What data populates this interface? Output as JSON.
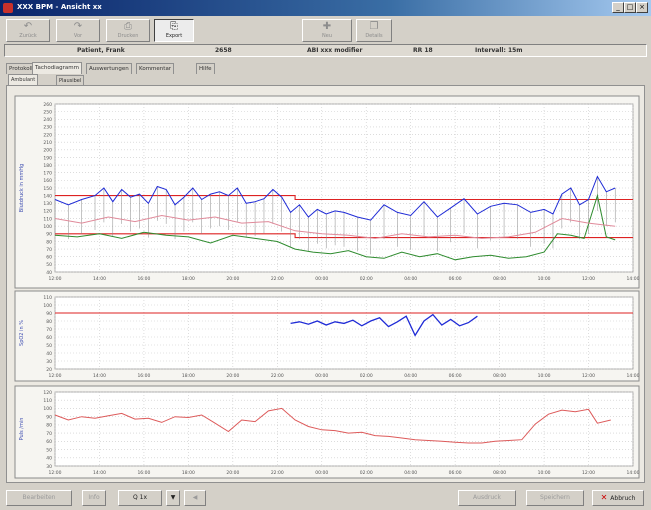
{
  "window": {
    "title": "XXX BPM  ‑ Ansicht xx"
  },
  "toolbar": {
    "buttons": [
      {
        "label": "Zurück",
        "icon": "back-icon"
      },
      {
        "label": "Vor",
        "icon": "forward-icon"
      },
      {
        "label": "Drucken",
        "icon": "print-icon"
      },
      {
        "label": "Export",
        "icon": "export-icon"
      },
      {
        "label": "Neu",
        "icon": "new-icon"
      },
      {
        "label": "Details",
        "icon": "details-icon"
      }
    ]
  },
  "infobar": {
    "patient": "Patient, Frank",
    "id": "2658",
    "device": "ABI xxx modifier",
    "rr": "RR 18",
    "interval": "Intervall: 15m"
  },
  "tabs": {
    "main": [
      "Protokoll",
      "Tachodiagramm",
      "Auswertungen",
      "Kommentar",
      "Hilfe"
    ],
    "sub": [
      "Ambulant",
      "Plausibel"
    ],
    "active_main": 1,
    "active_sub": 0
  },
  "bottom": {
    "buttons": [
      "Bearbeiten",
      "Info",
      "Q 1x",
      "▼",
      "◀",
      "Ausdruck",
      "Speichern",
      "Abbruch"
    ]
  },
  "colors": {
    "systolic": "#1f2bd6",
    "diastolic": "#2e8b2e",
    "mean": "#e08a9a",
    "threshold": "#dd2222",
    "spo2": "#1f2bd6",
    "pulse": "#dd5a5a"
  },
  "chart_data": [
    {
      "type": "line",
      "ylabel": "Blutdruck in mmHg",
      "ylim": [
        40,
        260
      ],
      "yticks": [
        40,
        50,
        60,
        70,
        80,
        90,
        100,
        110,
        120,
        130,
        140,
        150,
        160,
        170,
        180,
        190,
        200,
        210,
        220,
        230,
        240,
        250,
        260
      ],
      "xticks": [
        "12:00",
        "14:00",
        "16:00",
        "18:00",
        "20:00",
        "22:00",
        "00:00",
        "02:00",
        "04:00",
        "06:00",
        "08:00",
        "10:00",
        "12:00",
        "14:00"
      ],
      "thresholds": [
        {
          "name": "Systole Grenzwert",
          "points": [
            [
              0,
              140
            ],
            [
              5.4,
              140
            ],
            [
              5.4,
              135
            ],
            [
              13,
              135
            ]
          ]
        },
        {
          "name": "Diastole Grenzwert",
          "points": [
            [
              0,
              90
            ],
            [
              5.4,
              90
            ],
            [
              5.4,
              85
            ],
            [
              13,
              85
            ]
          ]
        }
      ],
      "series": [
        {
          "name": "Systole",
          "x": [
            0,
            0.3,
            0.6,
            0.9,
            1.1,
            1.3,
            1.5,
            1.7,
            1.9,
            2.1,
            2.3,
            2.5,
            2.7,
            2.9,
            3.1,
            3.3,
            3.5,
            3.7,
            3.9,
            4.1,
            4.3,
            4.5,
            4.7,
            4.9,
            5.1,
            5.3,
            5.5,
            5.7,
            5.9,
            6.1,
            6.3,
            6.5,
            6.8,
            7.1,
            7.4,
            7.7,
            8.0,
            8.3,
            8.6,
            8.9,
            9.2,
            9.5,
            9.8,
            10.1,
            10.4,
            10.7,
            11.0,
            11.2,
            11.4,
            11.6,
            11.8,
            12.0,
            12.2,
            12.4,
            12.6
          ],
          "y": [
            135,
            128,
            135,
            140,
            150,
            132,
            148,
            138,
            142,
            130,
            152,
            148,
            128,
            138,
            150,
            135,
            142,
            145,
            140,
            150,
            130,
            132,
            136,
            148,
            138,
            118,
            128,
            112,
            122,
            116,
            120,
            118,
            112,
            108,
            128,
            118,
            114,
            132,
            112,
            124,
            136,
            116,
            126,
            130,
            128,
            118,
            122,
            116,
            142,
            150,
            128,
            135,
            165,
            145,
            150
          ]
        },
        {
          "name": "Diastole",
          "x": [
            0,
            0.5,
            1.0,
            1.5,
            2.0,
            2.5,
            3.0,
            3.5,
            4.0,
            4.5,
            5.0,
            5.4,
            5.8,
            6.2,
            6.6,
            7.0,
            7.4,
            7.8,
            8.2,
            8.6,
            9.0,
            9.4,
            9.8,
            10.2,
            10.6,
            11.0,
            11.3,
            11.6,
            11.9,
            12.2,
            12.4,
            12.6
          ],
          "y": [
            88,
            86,
            90,
            84,
            92,
            88,
            86,
            78,
            88,
            84,
            80,
            70,
            66,
            64,
            68,
            60,
            58,
            66,
            60,
            64,
            56,
            60,
            62,
            58,
            60,
            66,
            90,
            88,
            84,
            140,
            86,
            82
          ]
        },
        {
          "name": "Mittelwert",
          "x": [
            0,
            0.6,
            1.2,
            1.8,
            2.4,
            3.0,
            3.6,
            4.2,
            4.8,
            5.4,
            6.0,
            6.6,
            7.2,
            7.8,
            8.4,
            9.0,
            9.6,
            10.2,
            10.8,
            11.4,
            12.0,
            12.6
          ],
          "y": [
            110,
            104,
            112,
            106,
            114,
            108,
            112,
            104,
            106,
            94,
            90,
            88,
            84,
            90,
            86,
            88,
            84,
            86,
            92,
            110,
            104,
            100
          ]
        }
      ]
    },
    {
      "type": "line",
      "ylabel": "SpO2 in %",
      "ylim": [
        20,
        110
      ],
      "yticks": [
        20,
        30,
        40,
        50,
        60,
        70,
        80,
        90,
        100,
        110
      ],
      "xticks": [
        "12:00",
        "14:00",
        "16:00",
        "18:00",
        "20:00",
        "22:00",
        "00:00",
        "02:00",
        "04:00",
        "06:00",
        "08:00",
        "10:00",
        "12:00",
        "14:00"
      ],
      "thresholds": [
        {
          "name": "SpO2 Grenzwert",
          "points": [
            [
              0,
              90
            ],
            [
              13,
              90
            ]
          ]
        }
      ],
      "series": [
        {
          "name": "SpO2",
          "x": [
            5.3,
            5.5,
            5.7,
            5.9,
            6.1,
            6.3,
            6.5,
            6.7,
            6.9,
            7.1,
            7.3,
            7.5,
            7.7,
            7.9,
            8.1,
            8.3,
            8.5,
            8.7,
            8.9,
            9.1,
            9.3,
            9.5
          ],
          "y": [
            77,
            79,
            76,
            80,
            75,
            79,
            77,
            81,
            74,
            80,
            84,
            73,
            79,
            86,
            62,
            80,
            88,
            75,
            82,
            74,
            78,
            86
          ]
        }
      ]
    },
    {
      "type": "line",
      "ylabel": "Puls /min",
      "ylim": [
        30,
        120
      ],
      "yticks": [
        30,
        40,
        50,
        60,
        70,
        80,
        90,
        100,
        110,
        120
      ],
      "xticks": [
        "12:00",
        "14:00",
        "16:00",
        "18:00",
        "20:00",
        "22:00",
        "00:00",
        "02:00",
        "04:00",
        "06:00",
        "08:00",
        "10:00",
        "12:00",
        "14:00"
      ],
      "series": [
        {
          "name": "Puls",
          "x": [
            0,
            0.3,
            0.6,
            0.9,
            1.2,
            1.5,
            1.8,
            2.1,
            2.4,
            2.7,
            3.0,
            3.3,
            3.6,
            3.9,
            4.2,
            4.5,
            4.8,
            5.1,
            5.4,
            5.7,
            6.0,
            6.3,
            6.6,
            6.9,
            7.2,
            7.5,
            7.8,
            8.1,
            8.4,
            8.7,
            9.0,
            9.3,
            9.6,
            9.9,
            10.2,
            10.5,
            10.8,
            11.1,
            11.4,
            11.7,
            12.0,
            12.2,
            12.5
          ],
          "y": [
            92,
            86,
            90,
            88,
            91,
            94,
            87,
            88,
            83,
            90,
            89,
            92,
            82,
            72,
            86,
            84,
            97,
            100,
            86,
            78,
            74,
            73,
            70,
            71,
            67,
            66,
            64,
            62,
            61,
            60,
            59,
            58,
            58,
            60,
            61,
            62,
            81,
            93,
            98,
            96,
            99,
            82,
            86
          ]
        }
      ]
    }
  ]
}
